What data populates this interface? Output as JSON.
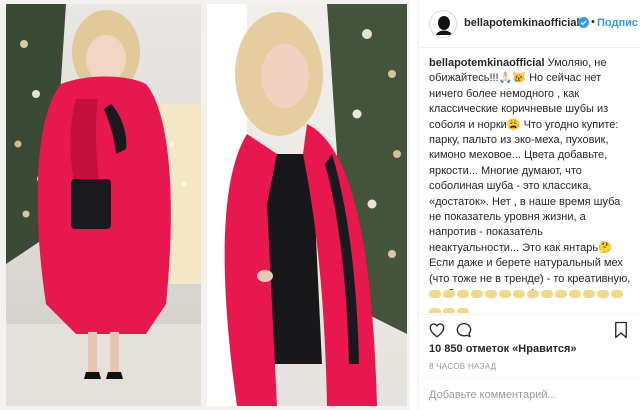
{
  "post": {
    "username": "bellapotemkinaofficial",
    "follow_label": "Подпис",
    "caption_author": "bellapotemkinaofficial",
    "caption_text": " Умоляю, не обижайтесь!!!🙏🏻😿 Но сейчас нет ничего более немодного , как классические коричневые шубы из соболя и норки😩 Что угодно купите: парку, пальто из эко-меха, пуховик, кимоно меховое... Цвета добавьте, яркости... Многие думают, что соболиная шуба - это классика, «достаток». Нет , в наше время шуба не показатель уровня жизни, а напротив - показатель неактуальности... Это как янтарь🤔 Если даже и берете натуральный мех (что тоже не в тренде) - то креативную, комбинированную, фиолетовую я не знаю🤷‍♀️ С рисунком каким-то😎 С интересными карманами🤔 Знаю, что у половины страны закуплены соболя... Но прислушайтесь, пожалуйста!😇🙏🏻",
    "likes_text": "10 850 отметок «Нравится»",
    "timestamp": "8 часов назад",
    "comment_placeholder": "Добавьте комментарий..."
  },
  "icons": {
    "verified": "verified-badge-icon",
    "like": "heart-icon",
    "comment": "comment-bubble-icon",
    "save": "bookmark-icon",
    "emoji": "clapping-hands-emoji"
  },
  "colors": {
    "link_blue": "#3897f0",
    "fur_pink": "#e8174e",
    "text": "#262626",
    "muted": "#999999"
  }
}
